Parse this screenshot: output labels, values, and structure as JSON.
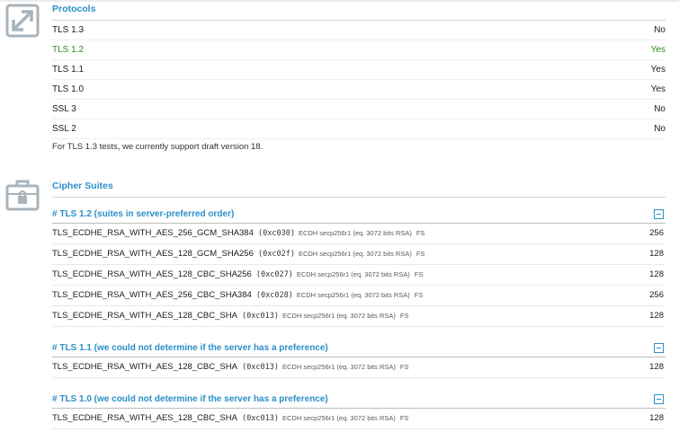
{
  "protocols": {
    "title": "Protocols",
    "rows": [
      {
        "name": "TLS 1.3",
        "value": "No",
        "highlight": false
      },
      {
        "name": "TLS 1.2",
        "value": "Yes",
        "highlight": true
      },
      {
        "name": "TLS 1.1",
        "value": "Yes",
        "highlight": false
      },
      {
        "name": "TLS 1.0",
        "value": "Yes",
        "highlight": false
      },
      {
        "name": "SSL 3",
        "value": "No",
        "highlight": false
      },
      {
        "name": "SSL 2",
        "value": "No",
        "highlight": false
      }
    ],
    "note": "For TLS 1.3 tests, we currently support draft version 18."
  },
  "ciphers": {
    "title": "Cipher Suites",
    "groups": [
      {
        "heading": "# TLS 1.2 (suites in server-preferred order)",
        "suites": [
          {
            "name": "TLS_ECDHE_RSA_WITH_AES_256_GCM_SHA384",
            "code": "(0xc030)",
            "info": "ECDH secp256r1 (eq. 3072 bits RSA)",
            "fs": "FS",
            "bits": "256"
          },
          {
            "name": "TLS_ECDHE_RSA_WITH_AES_128_GCM_SHA256",
            "code": "(0xc02f)",
            "info": "ECDH secp256r1 (eq. 3072 bits RSA)",
            "fs": "FS",
            "bits": "128"
          },
          {
            "name": "TLS_ECDHE_RSA_WITH_AES_128_CBC_SHA256",
            "code": "(0xc027)",
            "info": "ECDH secp256r1 (eq. 3072 bits RSA)",
            "fs": "FS",
            "bits": "128"
          },
          {
            "name": "TLS_ECDHE_RSA_WITH_AES_256_CBC_SHA384",
            "code": "(0xc028)",
            "info": "ECDH secp256r1 (eq. 3072 bits RSA)",
            "fs": "FS",
            "bits": "256"
          },
          {
            "name": "TLS_ECDHE_RSA_WITH_AES_128_CBC_SHA",
            "code": "(0xc013)",
            "info": "ECDH secp256r1 (eq. 3072 bits RSA)",
            "fs": "FS",
            "bits": "128"
          }
        ]
      },
      {
        "heading": "# TLS 1.1 (we could not determine if the server has a preference)",
        "suites": [
          {
            "name": "TLS_ECDHE_RSA_WITH_AES_128_CBC_SHA",
            "code": "(0xc013)",
            "info": "ECDH secp256r1 (eq. 3072 bits RSA)",
            "fs": "FS",
            "bits": "128"
          }
        ]
      },
      {
        "heading": "# TLS 1.0 (we could not determine if the server has a preference)",
        "suites": [
          {
            "name": "TLS_ECDHE_RSA_WITH_AES_128_CBC_SHA",
            "code": "(0xc013)",
            "info": "ECDH secp256r1 (eq. 3072 bits RSA)",
            "fs": "FS",
            "bits": "128"
          }
        ]
      }
    ]
  },
  "icons": {
    "protocols": "expand-arrows-icon",
    "ciphers": "locked-briefcase-icon"
  },
  "colors": {
    "accent": "#2b8fc8",
    "positive": "#2c8a1a",
    "icon": "#a9b3bb"
  }
}
